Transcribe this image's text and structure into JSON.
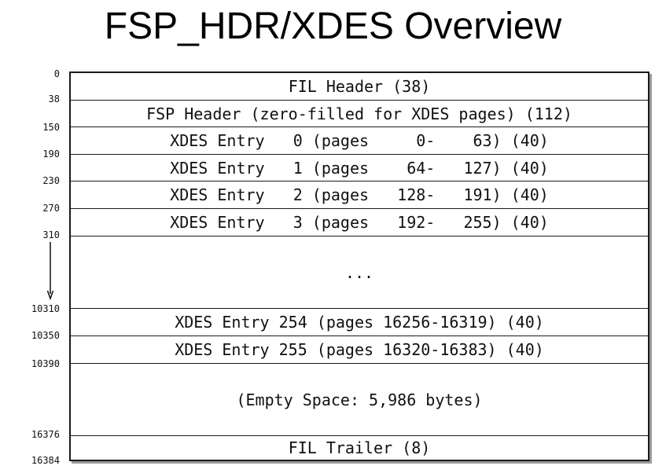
{
  "title": "FSP_HDR/XDES Overview",
  "offsets": [
    "0",
    "38",
    "150",
    "190",
    "230",
    "270",
    "310",
    "10310",
    "10350",
    "10390",
    "16376",
    "16384"
  ],
  "rows": [
    "FIL Header (38)",
    "FSP Header (zero-filled for XDES pages) (112)",
    "XDES Entry   0 (pages     0-    63) (40)",
    "XDES Entry   1 (pages    64-   127) (40)",
    "XDES Entry   2 (pages   128-   191) (40)",
    "XDES Entry   3 (pages   192-   255) (40)",
    "...",
    "XDES Entry 254 (pages 16256-16319) (40)",
    "XDES Entry 255 (pages 16320-16383) (40)",
    "(Empty Space: 5,986 bytes)",
    "FIL Trailer (8)"
  ]
}
